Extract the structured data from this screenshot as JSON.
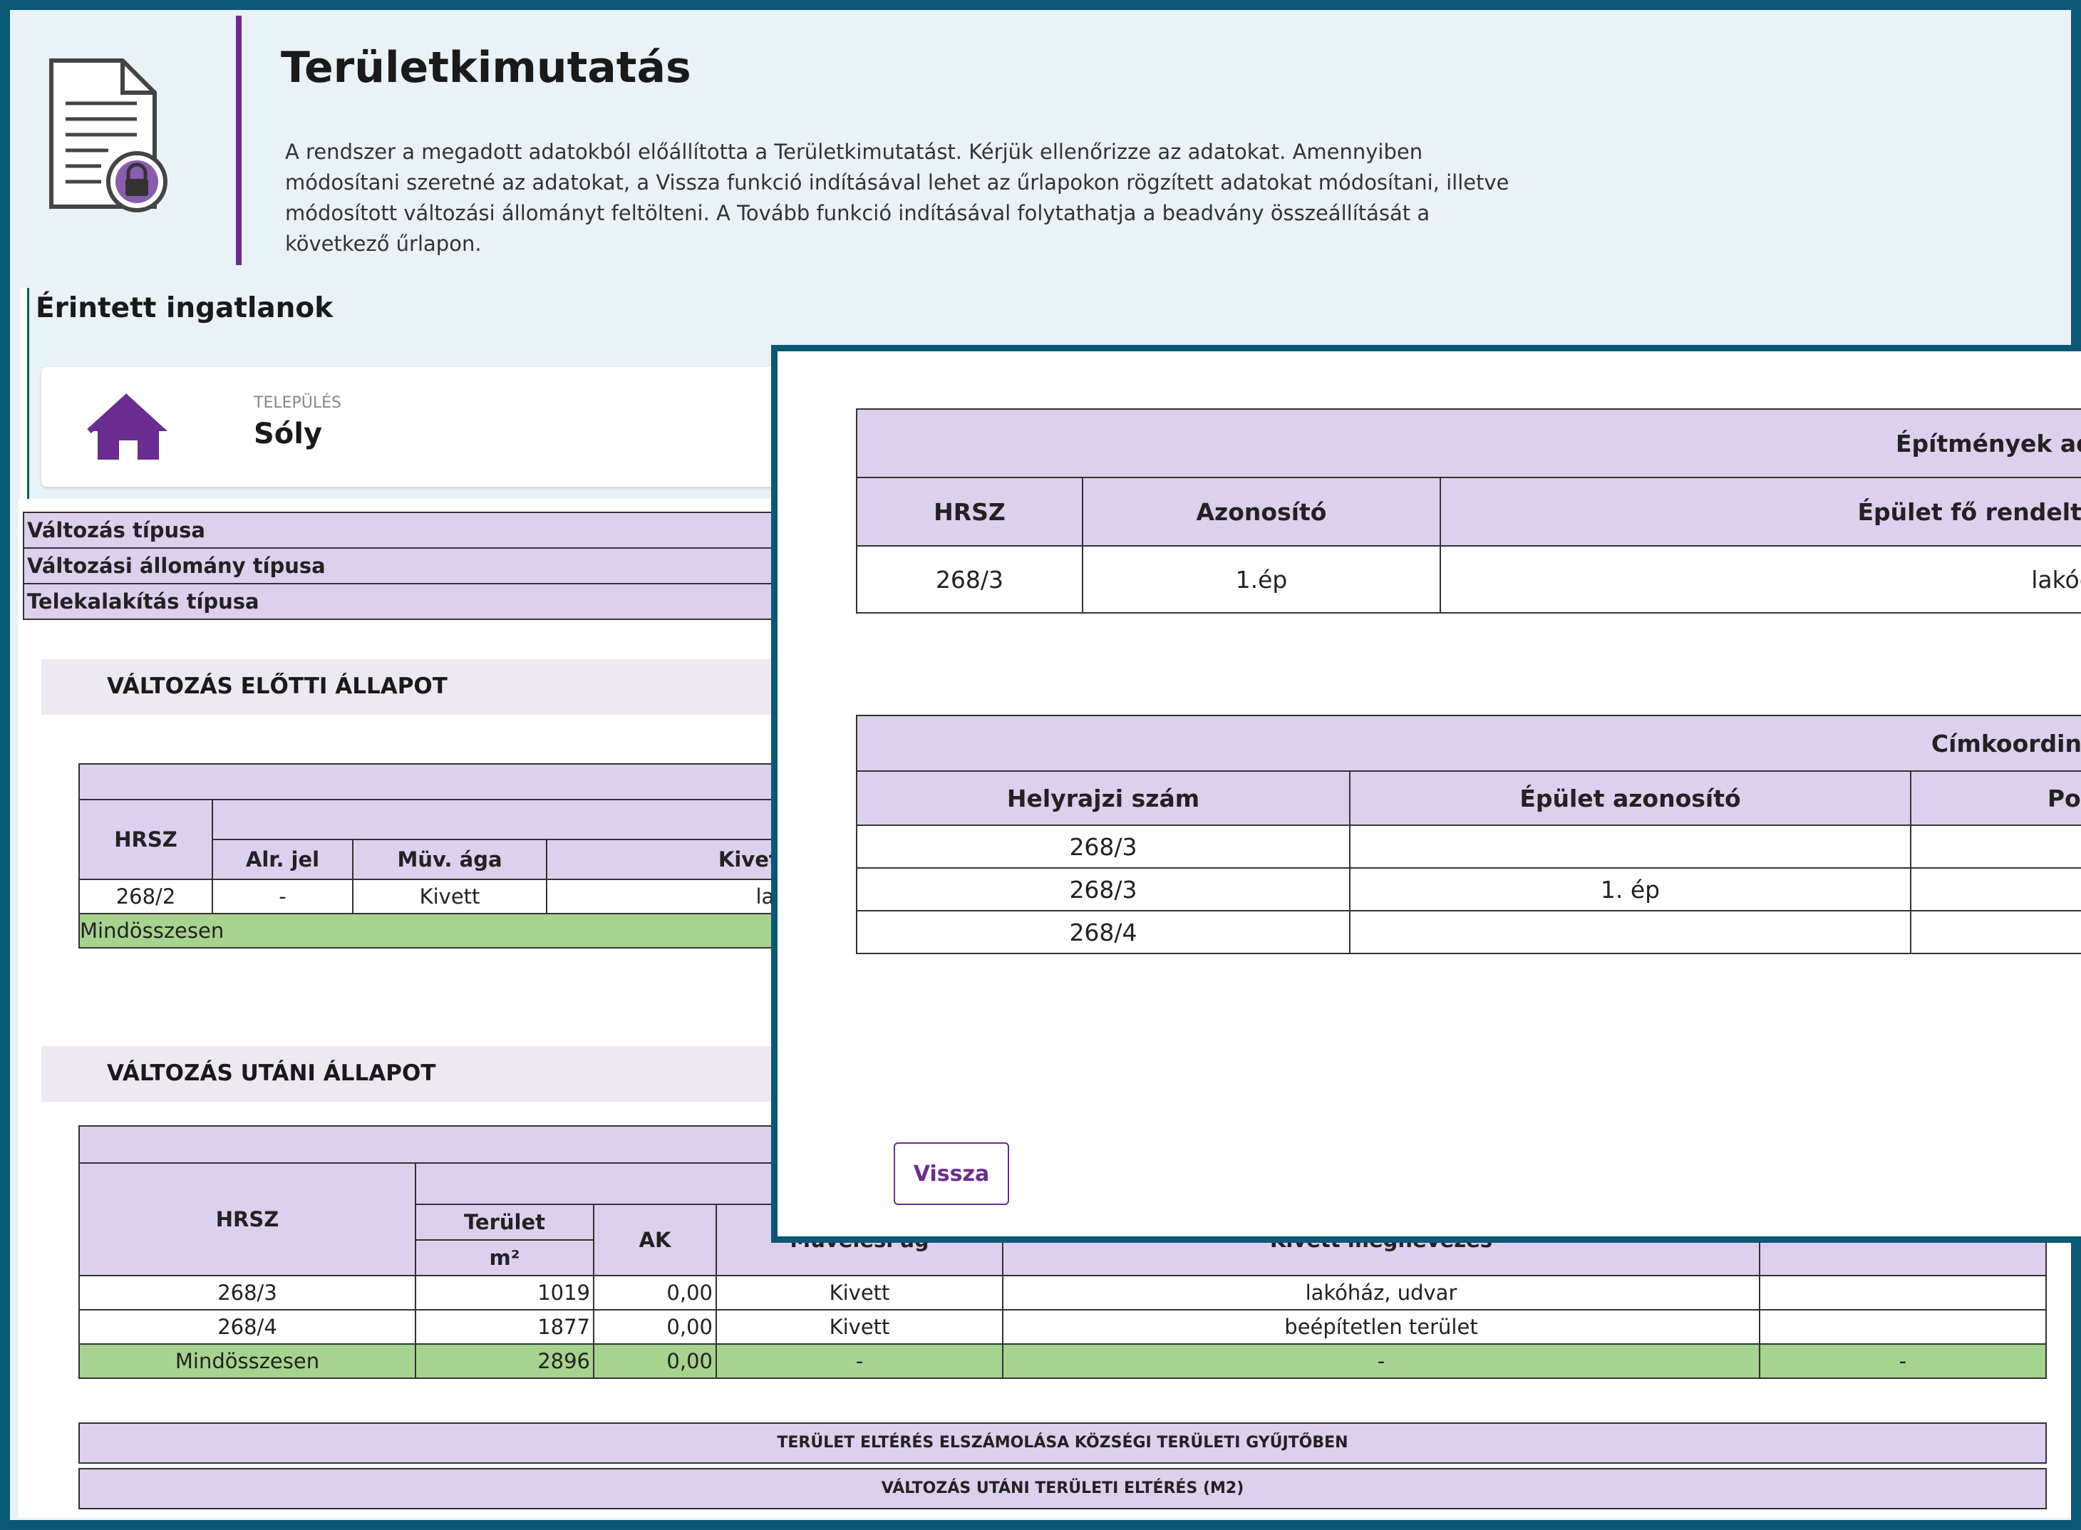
{
  "page": {
    "title": "Területkimutatás",
    "description": "A rendszer a megadott adatokból előállította a Területkimutatást. Kérjük ellenőrizze az adatokat. Amennyiben módosítani szeretné az adatokat, a Vissza funkció indításával lehet az űrlapokon rögzített adatokat módosítani, illetve módosított változási állományt feltölteni. A Tovább funkció indításával folytathatja a beadvány összeállítását a következő űrlapon.",
    "section_title": "Érintett ingatlanok"
  },
  "settlement": {
    "label": "TELEPÜLÉS",
    "name": "Sóly"
  },
  "info_rows": [
    "Változás típusa",
    "Változási állomány típusa",
    "Telekalakítás típusa"
  ],
  "before": {
    "title": "VÁLTOZÁS ELŐTTI ÁLLAPOT",
    "headers": {
      "hrsz": "HRSZ",
      "alr": "Alr. jel",
      "muv": "Müv. ága",
      "kivett": "Kivett megn"
    },
    "row": {
      "hrsz": "268/2",
      "alr": "-",
      "muv": "Kivett",
      "kivett": "lakóház, u"
    },
    "total_label": "Mindösszesen"
  },
  "after": {
    "title": "VÁLTOZÁS UTÁNI ÁLLAPOT",
    "headers": {
      "hrsz": "HRSZ",
      "terulet": "Terület",
      "unit": "m²",
      "ak": "AK",
      "muv": "Művelési ág",
      "kivett": "Kivett megnevezés"
    },
    "rows": [
      {
        "hrsz": "268/3",
        "terulet": "1019",
        "ak": "0,00",
        "muv": "Kivett",
        "kivett": "lakóház, udvar",
        "extra": ""
      },
      {
        "hrsz": "268/4",
        "terulet": "1877",
        "ak": "0,00",
        "muv": "Kivett",
        "kivett": "beépítetlen terület",
        "extra": ""
      }
    ],
    "total": {
      "label": "Mindösszesen",
      "terulet": "2896",
      "ak": "0,00",
      "muv": "-",
      "kivett": "-",
      "extra": "-"
    }
  },
  "footer_rows": [
    "TERÜLET ELTÉRÉS ELSZÁMOLÁSA KÖZSÉGI TERÜLETI GYŰJTŐBEN",
    "VÁLTOZÁS UTÁNI TERÜLETI ELTÉRÉS (M2)"
  ],
  "modal": {
    "buildings": {
      "title": "Építmények ada",
      "headers": {
        "hrsz": "HRSZ",
        "azonosito": "Azonosító",
        "rendeltetes": "Épület fő rendeltet"
      },
      "row": {
        "hrsz": "268/3",
        "azonosito": "1.ép",
        "rendeltetes": "lakóép"
      }
    },
    "coords": {
      "title": "Címkoordinát",
      "headers": {
        "hrsz": "Helyrajzi szám",
        "epulet": "Épület azonosító",
        "pont": "Pont"
      },
      "rows": [
        {
          "hrsz": "268/3",
          "epulet": ""
        },
        {
          "hrsz": "268/3",
          "epulet": "1. ép"
        },
        {
          "hrsz": "268/4",
          "epulet": ""
        }
      ]
    },
    "back_button": "Vissza"
  },
  "colors": {
    "accent": "#6a2c91",
    "frame": "#0b5876",
    "header_bg": "#ddd0ee",
    "total_bg": "#a6d38e"
  }
}
